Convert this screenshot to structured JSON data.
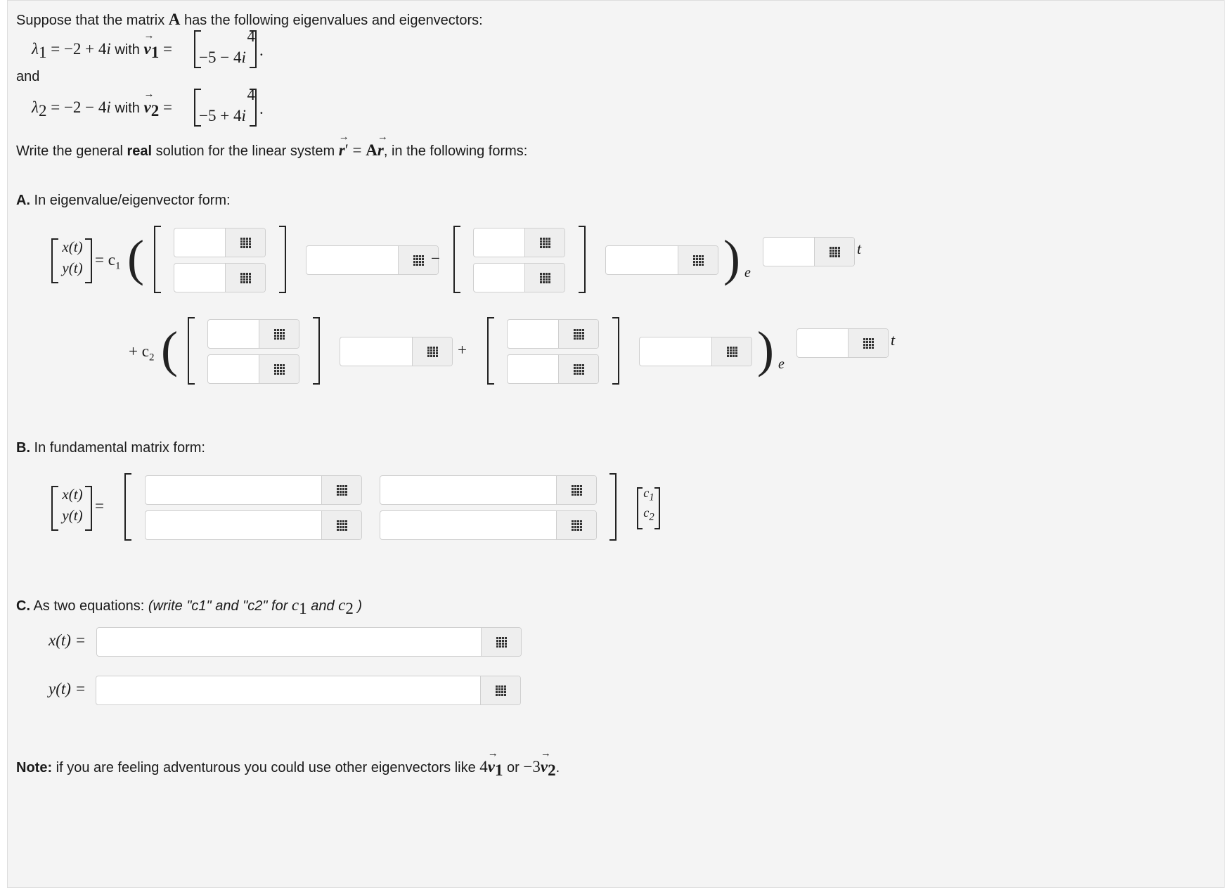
{
  "intro": {
    "text_pre": "Suppose that the matrix ",
    "matrix": "A",
    "text_post": " has the following eigenvalues and eigenvectors:",
    "lambda1": {
      "lhs": "λ",
      "sub": "1",
      "value": " = −2 + 4",
      "i": "i",
      "with": " with ",
      "v": "v",
      "vsub": "1",
      "eq": " =",
      "top": "4",
      "bottom": "−5 − 4",
      "bottom_i": "i",
      "period": "."
    },
    "and": "and",
    "lambda2": {
      "lhs": "λ",
      "sub": "2",
      "value": " = −2 − 4",
      "i": "i",
      "with": " with ",
      "v": "v",
      "vsub": "2",
      "eq": " =",
      "top": "4",
      "bottom": "−5 + 4",
      "bottom_i": "i",
      "period": "."
    },
    "instruction": {
      "pre": "Write the general ",
      "bold": "real",
      "mid": " solution for the linear system ",
      "r": "r",
      "prime": "′ = ",
      "A": "A",
      "r2": "r",
      "post": ", in the following forms:"
    }
  },
  "partA": {
    "label": "A.",
    "title": " In eigenvalue/eigenvector form:",
    "lhs_x": "x(t)",
    "lhs_y": "y(t)",
    "eq": "= c",
    "c1sub": "1",
    "minus": "−",
    "e": "e",
    "t": "t",
    "c2": "+ c",
    "c2sub": "2",
    "plus": "+"
  },
  "partB": {
    "label": "B.",
    "title": " In fundamental matrix form:",
    "lhs_x": "x(t)",
    "lhs_y": "y(t)",
    "eq": "=",
    "c1": "c",
    "c1sub": "1",
    "c2": "c",
    "c2sub": "2"
  },
  "partC": {
    "label": "C.",
    "title": " As two equations: ",
    "hint_pre": "(write \"c1\" and \"c2\" for ",
    "hint_c1": "c",
    "hint_c1sub": "1",
    "hint_and": " and ",
    "hint_c2": "c",
    "hint_c2sub": "2",
    "hint_post": " )",
    "x_label": "x(t) =",
    "y_label": "y(t) ="
  },
  "note": {
    "label": "Note:",
    "text": " if you are feeling adventurous you could use other eigenvectors like ",
    "ex1": "4",
    "v1": "v",
    "v1sub": "1",
    "or": " or ",
    "ex2": "−3",
    "v2": "v",
    "v2sub": "2",
    "period": "."
  },
  "icons": {
    "matrix_button": "grid-icon"
  }
}
